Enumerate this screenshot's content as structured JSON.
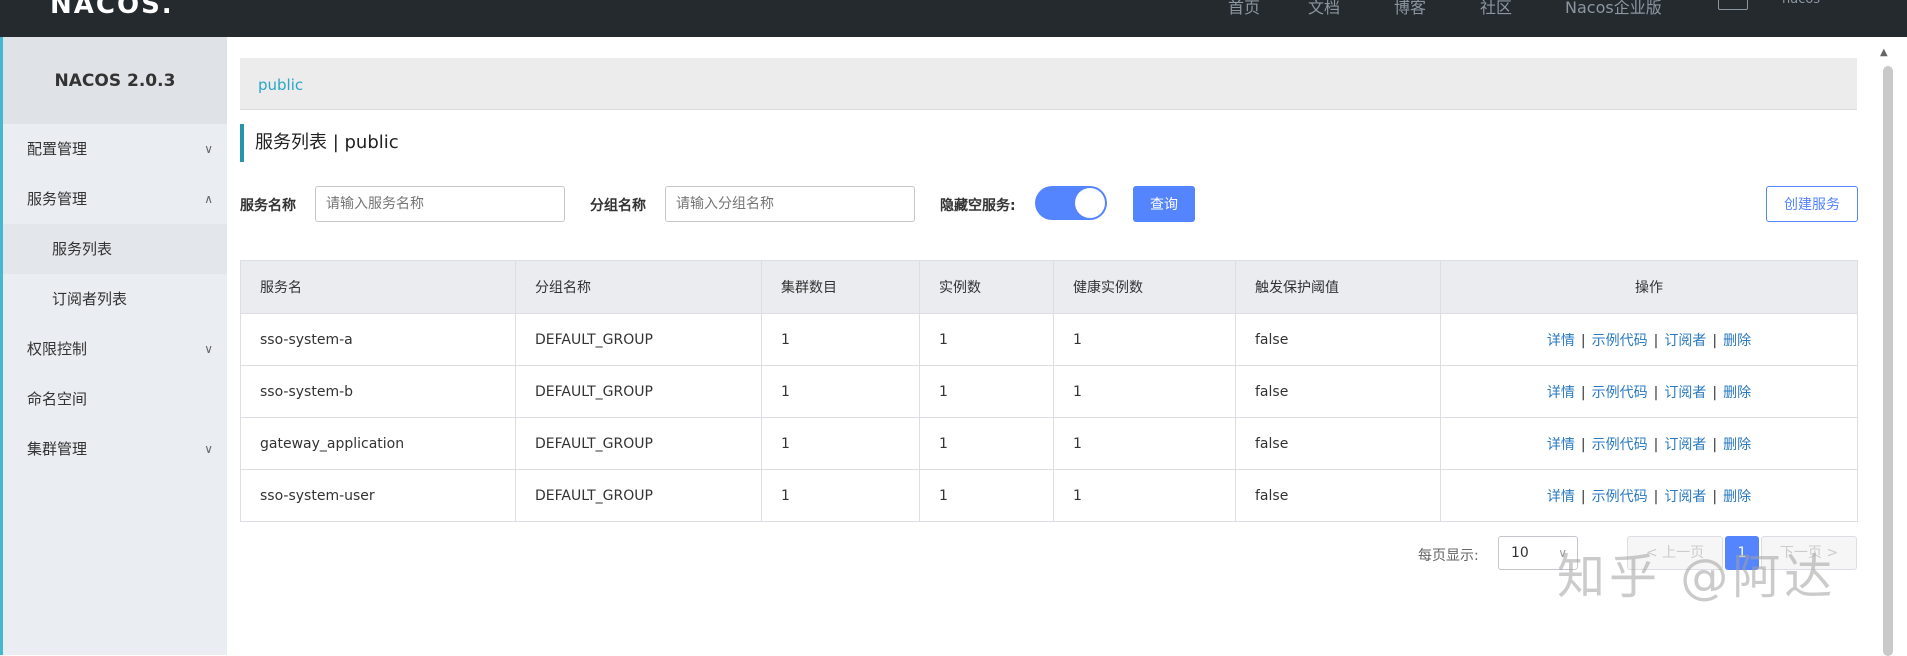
{
  "topbar": {
    "logo": "NACOS.",
    "nav": [
      "首页",
      "文档",
      "博客",
      "社区",
      "Nacos企业版"
    ],
    "user": "nacos"
  },
  "sidebar": {
    "title": "NACOS 2.0.3",
    "items": [
      {
        "label": "配置管理",
        "chevron": "∨"
      },
      {
        "label": "服务管理",
        "chevron": "∧"
      },
      {
        "label": "服务列表"
      },
      {
        "label": "订阅者列表"
      },
      {
        "label": "权限控制",
        "chevron": "∨"
      },
      {
        "label": "命名空间"
      },
      {
        "label": "集群管理",
        "chevron": "∨"
      }
    ]
  },
  "breadcrumb": "public",
  "page_title": "服务列表  |  public",
  "filters": {
    "service_name_label": "服务名称",
    "service_name_placeholder": "请输入服务名称",
    "group_name_label": "分组名称",
    "group_name_placeholder": "请输入分组名称",
    "hide_empty_label": "隐藏空服务:",
    "query_label": "查询",
    "create_label": "创建服务"
  },
  "table": {
    "headers": [
      "服务名",
      "分组名称",
      "集群数目",
      "实例数",
      "健康实例数",
      "触发保护阈值",
      "操作"
    ],
    "rows": [
      [
        "sso-system-a",
        "DEFAULT_GROUP",
        "1",
        "1",
        "1",
        "false"
      ],
      [
        "sso-system-b",
        "DEFAULT_GROUP",
        "1",
        "1",
        "1",
        "false"
      ],
      [
        "gateway_application",
        "DEFAULT_GROUP",
        "1",
        "1",
        "1",
        "false"
      ],
      [
        "sso-system-user",
        "DEFAULT_GROUP",
        "1",
        "1",
        "1",
        "false"
      ]
    ],
    "ops": [
      "详情",
      "示例代码",
      "订阅者",
      "删除"
    ]
  },
  "pagination": {
    "page_size_label": "每页显示:",
    "page_size": "10",
    "prev": "< 上一页",
    "current": "1",
    "next": "下一页 >"
  },
  "watermark": "知乎 @阿达",
  "colors": {
    "accent": "#5584ff",
    "link": "#2a7ac0",
    "topbar": "#252a2f"
  }
}
